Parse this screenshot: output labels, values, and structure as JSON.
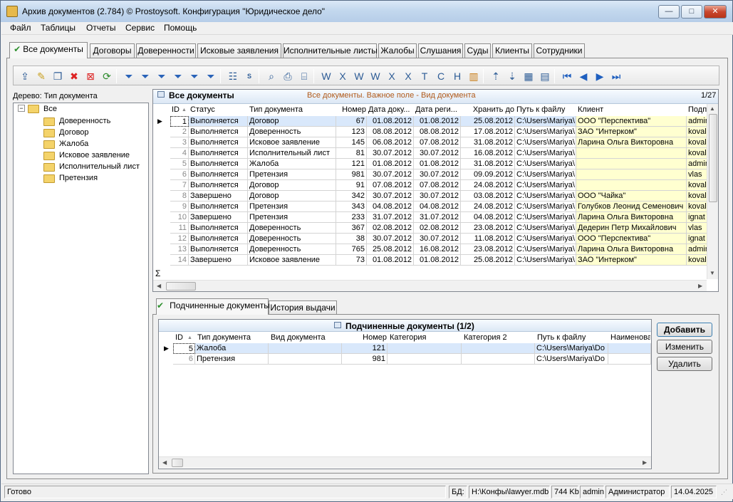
{
  "window": {
    "title": "Архив документов (2.784) © Prostoysoft. Конфигурация \"Юридическое дело\"",
    "min": "—",
    "max": "□",
    "close": "✕"
  },
  "menu": [
    "Файл",
    "Таблицы",
    "Отчеты",
    "Сервис",
    "Помощь"
  ],
  "tabs": [
    "Все документы",
    "Договоры",
    "Доверенности",
    "Исковые заявления",
    "Исполнительные листы",
    "Жалобы",
    "Слушания",
    "Суды",
    "Клиенты",
    "Сотрудники"
  ],
  "toolbar_icons": [
    "export-icon",
    "edit-icon",
    "copy-icon",
    "delete-icon",
    "delete-all-icon",
    "refresh-icon",
    "filter-icon",
    "filter-clear-icon",
    "filter-remove-icon",
    "filter-edit-icon",
    "filter-apply-icon",
    "filter-list-icon",
    "tree-icon",
    "sql-icon",
    "find-icon",
    "print-icon",
    "preview-icon",
    "word-export-icon",
    "excel-export-icon",
    "word-doc-icon",
    "word-icon",
    "excel-icon",
    "excel-doc-icon",
    "txt-icon",
    "csv-icon",
    "html-icon",
    "chart-icon",
    "doc-up-icon",
    "doc-down-icon",
    "table-icon",
    "table-edit-icon",
    "first-icon",
    "prev-icon",
    "next-icon",
    "last-icon"
  ],
  "tree": {
    "header": "Дерево: Тип документа",
    "root": "Все",
    "expander": "−",
    "items": [
      "Доверенность",
      "Договор",
      "Жалоба",
      "Исковое заявление",
      "Исполнительный лист",
      "Претензия"
    ]
  },
  "grid": {
    "title": "Все документы",
    "subtitle": "Все документы. Важное поле - Вид документа",
    "counter": "1/27",
    "sigma": "Σ",
    "columns": [
      "ID",
      "Статус",
      "Тип документа",
      "Номер",
      "Дата доку...",
      "Дата реги...",
      "Хранить до",
      "Путь к файлу",
      "Клиент",
      "Подп"
    ],
    "rows": [
      [
        "1",
        "Выполняется",
        "Договор",
        "67",
        "01.08.2012",
        "01.08.2012",
        "25.08.2012",
        "C:\\Users\\Mariya\\",
        "ООО \"Перспектива\"",
        "admin"
      ],
      [
        "2",
        "Выполняется",
        "Доверенность",
        "123",
        "08.08.2012",
        "08.08.2012",
        "17.08.2012",
        "C:\\Users\\Mariya\\",
        "ЗАО \"Интерком\"",
        "koval"
      ],
      [
        "3",
        "Выполняется",
        "Исковое заявление",
        "145",
        "06.08.2012",
        "07.08.2012",
        "31.08.2012",
        "C:\\Users\\Mariya\\",
        "Ларина Ольга Викторовна",
        "koval"
      ],
      [
        "4",
        "Выполняется",
        "Исполнительный лист",
        "81",
        "30.07.2012",
        "30.07.2012",
        "16.08.2012",
        "C:\\Users\\Mariya\\",
        "",
        "koval"
      ],
      [
        "5",
        "Выполняется",
        "Жалоба",
        "121",
        "01.08.2012",
        "01.08.2012",
        "31.08.2012",
        "C:\\Users\\Mariya\\",
        "",
        "admin"
      ],
      [
        "6",
        "Выполняется",
        "Претензия",
        "981",
        "30.07.2012",
        "30.07.2012",
        "09.09.2012",
        "C:\\Users\\Mariya\\",
        "",
        "vlas"
      ],
      [
        "7",
        "Выполняется",
        "Договор",
        "91",
        "07.08.2012",
        "07.08.2012",
        "24.08.2012",
        "C:\\Users\\Mariya\\",
        "",
        "koval"
      ],
      [
        "8",
        "Завершено",
        "Договор",
        "342",
        "30.07.2012",
        "30.07.2012",
        "03.08.2012",
        "C:\\Users\\Mariya\\",
        "ООО \"Чайка\"",
        "koval"
      ],
      [
        "9",
        "Выполняется",
        "Претензия",
        "343",
        "04.08.2012",
        "04.08.2012",
        "24.08.2012",
        "C:\\Users\\Mariya\\",
        "Голубков Леонид Семенович",
        "koval"
      ],
      [
        "10",
        "Завершено",
        "Претензия",
        "233",
        "31.07.2012",
        "31.07.2012",
        "04.08.2012",
        "C:\\Users\\Mariya\\",
        "Ларина Ольга Викторовна",
        "ignat"
      ],
      [
        "11",
        "Выполняется",
        "Доверенность",
        "367",
        "02.08.2012",
        "02.08.2012",
        "23.08.2012",
        "C:\\Users\\Mariya\\",
        "Дедерин Петр Михайлович",
        "vlas"
      ],
      [
        "12",
        "Выполняется",
        "Доверенность",
        "38",
        "30.07.2012",
        "30.07.2012",
        "11.08.2012",
        "C:\\Users\\Mariya\\",
        "ООО \"Перспектива\"",
        "ignat"
      ],
      [
        "13",
        "Выполняется",
        "Доверенность",
        "765",
        "25.08.2012",
        "16.08.2012",
        "23.08.2012",
        "C:\\Users\\Mariya\\",
        "Ларина Ольга Викторовна",
        "admin"
      ],
      [
        "14",
        "Завершено",
        "Исковое заявление",
        "73",
        "01.08.2012",
        "01.08.2012",
        "25.08.2012",
        "C:\\Users\\Mariya\\",
        "ЗАО \"Интерком\"",
        "koval"
      ]
    ]
  },
  "subtabs": [
    "Подчиненные документы",
    "История выдачи"
  ],
  "subgrid": {
    "title": "Подчиненные документы (1/2)",
    "columns": [
      "ID",
      "Тип документа",
      "Вид документа",
      "Номер",
      "Категория",
      "Категория 2",
      "Путь к файлу",
      "Наименова"
    ],
    "rows": [
      [
        "5",
        "Жалоба",
        "",
        "121",
        "",
        "",
        "C:\\Users\\Mariya\\Do",
        ""
      ],
      [
        "6",
        "Претензия",
        "",
        "981",
        "",
        "",
        "C:\\Users\\Mariya\\Do",
        ""
      ]
    ]
  },
  "buttons": {
    "add": "Добавить",
    "edit": "Изменить",
    "delete": "Удалить"
  },
  "status": {
    "ready": "Готово",
    "db_label": "БД:",
    "db_path": "H:\\Конфы\\lawyer.mdb",
    "size": "744 Kb",
    "user": "admin",
    "role": "Администратор",
    "date": "14.04.2025"
  },
  "colors": {
    "highlight": "#ffffd0",
    "selected": "#d9e8fb",
    "accent": "#0a246a"
  }
}
